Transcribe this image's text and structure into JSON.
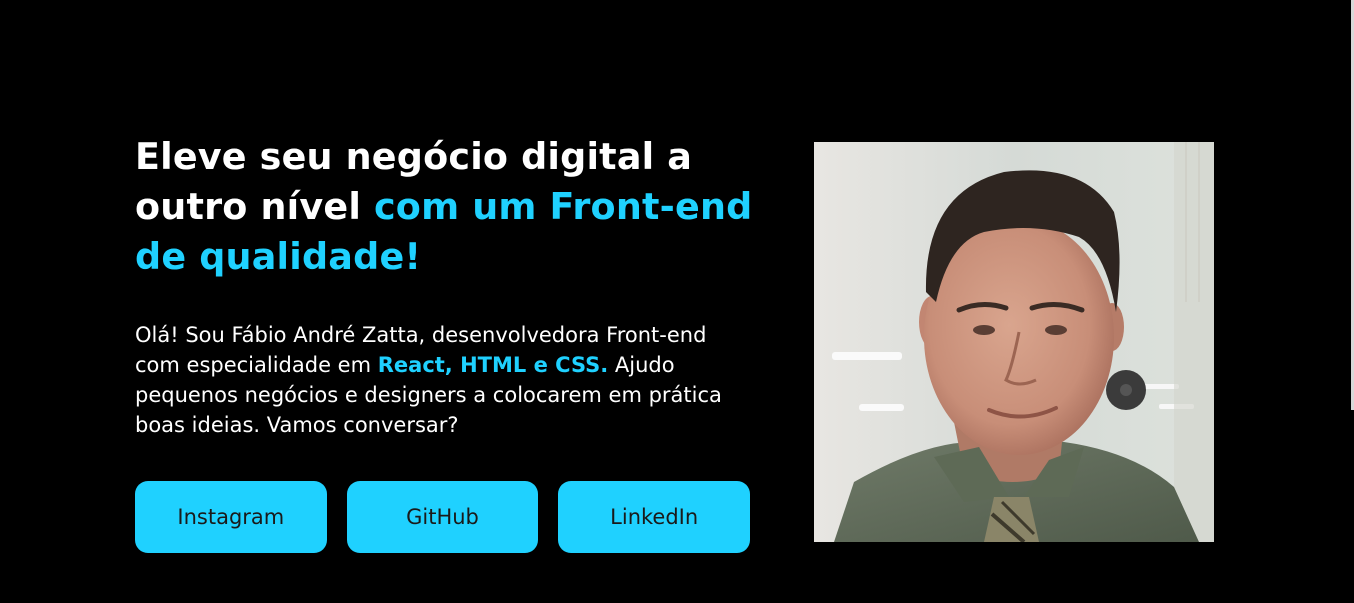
{
  "hero": {
    "headline_part1": "Eleve seu negócio digital a outro nível ",
    "headline_accent": "com um Front-end de qualidade!",
    "intro_part1": "Olá! Sou Fábio André Zatta, desenvolvedora Front-end com especialidade em ",
    "intro_accent": "React, HTML e CSS.",
    "intro_part2": " Ajudo pequenos negócios e designers a colocarem em prática boas ideias. Vamos conversar?"
  },
  "social_buttons": [
    {
      "label": "Instagram",
      "icon": "instagram"
    },
    {
      "label": "GitHub",
      "icon": "github"
    },
    {
      "label": "LinkedIn",
      "icon": "linkedin"
    }
  ],
  "colors": {
    "background": "#000000",
    "accent": "#1fd1ff",
    "text": "#ffffff"
  }
}
